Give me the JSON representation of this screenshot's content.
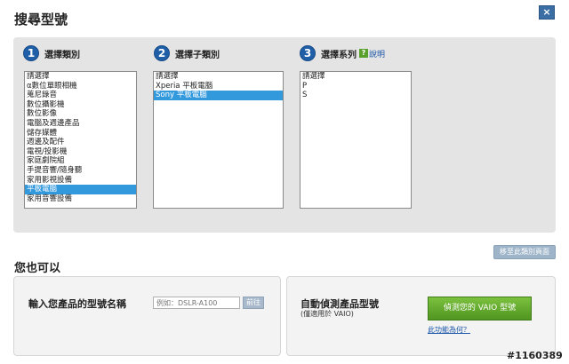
{
  "dialog": {
    "title": "搜尋型號",
    "close_label": "×"
  },
  "steps": [
    {
      "num": "1",
      "label": "選擇類別"
    },
    {
      "num": "2",
      "label": "選擇子類別"
    },
    {
      "num": "3",
      "label": "選擇系列",
      "help_link": "說明"
    }
  ],
  "category_list": {
    "options": [
      "請選擇",
      "α數位單眼相機",
      "蒐尼錄音",
      "數位攝影機",
      "數位影像",
      "電腦及週邊產品",
      "儲存媒體",
      "週邊及配件",
      "電視/投影機",
      "家庭劇院組",
      "手提音響/隨身聽",
      "家用影視設備",
      "平板電腦",
      "家用音響設備"
    ],
    "selected_index": 12
  },
  "subcategory_list": {
    "options": [
      "請選擇",
      "Xperia 平板電腦",
      "Sony 平板電腦"
    ],
    "selected_index": 2
  },
  "series_list": {
    "options": [
      "請選擇",
      "P",
      "S"
    ],
    "selected_index": -1
  },
  "back_button": "移至此類別頁面",
  "also_section": {
    "title": "您也可以"
  },
  "model_box": {
    "label": "輸入您產品的型號名稱",
    "input_placeholder": "例如：DSLR-A100",
    "go_label": "前往"
  },
  "detect_box": {
    "label": "自動偵測產品型號",
    "sublabel": "(僅適用於 VAIO)",
    "button_label": "偵測您的 VAIO 型號",
    "link_label": "此功能為何？"
  },
  "watermark": "#1160389"
}
